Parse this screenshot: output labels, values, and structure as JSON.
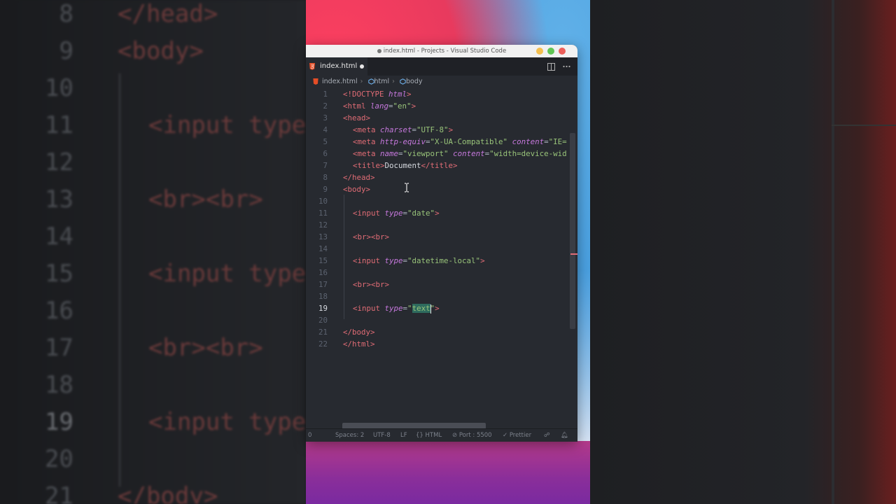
{
  "window": {
    "title": "index.html - Projects - Visual Studio Code",
    "traffic_lights": [
      "#f4bf4f",
      "#61c554",
      "#ec5f5a"
    ]
  },
  "tabs": [
    {
      "label": "index.html",
      "modified": true,
      "icon": "html5-icon"
    }
  ],
  "tab_actions": {
    "split": "split-editor-icon",
    "more": "more-actions-icon"
  },
  "breadcrumb": [
    "index.html",
    "html",
    "body"
  ],
  "editor": {
    "current_line": 19,
    "lines": [
      {
        "n": "1"
      },
      {
        "n": "2"
      },
      {
        "n": "3"
      },
      {
        "n": "4"
      },
      {
        "n": "5"
      },
      {
        "n": "6"
      },
      {
        "n": "7"
      },
      {
        "n": "8"
      },
      {
        "n": "9"
      },
      {
        "n": "10"
      },
      {
        "n": "11"
      },
      {
        "n": "12"
      },
      {
        "n": "13"
      },
      {
        "n": "14"
      },
      {
        "n": "15"
      },
      {
        "n": "16"
      },
      {
        "n": "17"
      },
      {
        "n": "18"
      },
      {
        "n": "19"
      },
      {
        "n": "20"
      },
      {
        "n": "21"
      },
      {
        "n": "22"
      }
    ],
    "code": {
      "l1a": "<!DOCTYPE ",
      "l1b": "html",
      "l1c": ">",
      "l2a": "<html ",
      "l2b": "lang",
      "l2c": "=",
      "l2d": "\"en\"",
      "l2e": ">",
      "l3": "<head>",
      "l4a": "<meta ",
      "l4b": "charset",
      "l4c": "=",
      "l4d": "\"UTF-8\"",
      "l4e": ">",
      "l5a": "<meta ",
      "l5b": "http-equiv",
      "l5c": "=",
      "l5d": "\"X-UA-Compatible\"",
      "l5e": " content",
      "l5f": "=",
      "l5g": "\"IE=",
      "l6a": "<meta ",
      "l6b": "name",
      "l6c": "=",
      "l6d": "\"viewport\"",
      "l6e": " content",
      "l6f": "=",
      "l6g": "\"width=device-wid",
      "l7a": "<title>",
      "l7b": "Document",
      "l7c": "</title>",
      "l8": "</head>",
      "l9": "<body>",
      "l11a": "<input ",
      "l11b": "type",
      "l11c": "=",
      "l11d": "\"date\"",
      "l11e": ">",
      "l13": "<br><br>",
      "l15a": "<input ",
      "l15b": "type",
      "l15c": "=",
      "l15d": "\"datetime-local\"",
      "l15e": ">",
      "l17": "<br><br>",
      "l19a": "<input ",
      "l19b": "type",
      "l19c": "=",
      "l19d": "\"",
      "l19e": "text",
      "l19f": "\"",
      "l19g": ">",
      "l21": "</body>",
      "l22": "</html>"
    }
  },
  "statusbar": {
    "left": "0",
    "spaces": "Spaces: 2",
    "encoding": "UTF-8",
    "eol": "LF",
    "language": "HTML",
    "port": "Port : 5500",
    "prettier": "Prettier"
  },
  "background": {
    "left_numbers": [
      "8",
      "9",
      "10",
      "11",
      "12",
      "13",
      "14",
      "15",
      "16",
      "17",
      "18",
      "19",
      "20",
      "21"
    ],
    "left_code": {
      "l8": "</head>",
      "l9": "<body>",
      "l11": "<input type",
      "l13": "<br><br>",
      "l15": "<input type",
      "l17": "<br><br>",
      "l19": "<input type",
      "l21": "</body>"
    }
  }
}
